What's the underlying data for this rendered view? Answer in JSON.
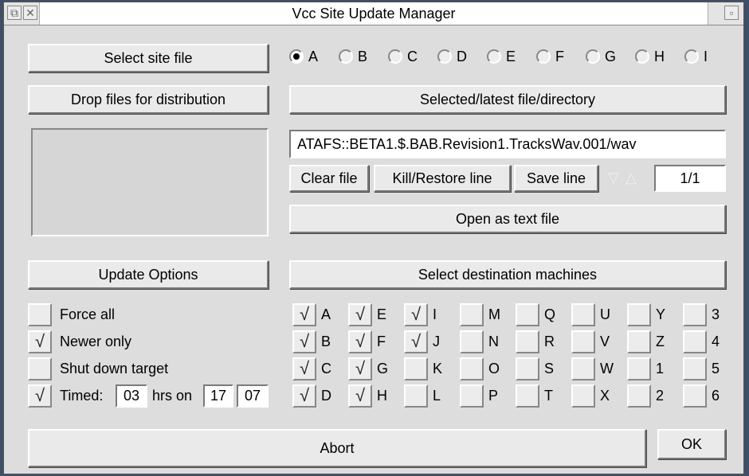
{
  "window": {
    "title": "Vcc Site Update Manager",
    "left_icons": [
      "⧉",
      "✕"
    ],
    "right_icon": "▫"
  },
  "left": {
    "select_site_label": "Select site file",
    "drop_files_label": "Drop files for distribution",
    "update_options_label": "Update Options",
    "options": [
      {
        "label": "Force all",
        "checked": false
      },
      {
        "label": "Newer only",
        "checked": true
      },
      {
        "label": "Shut down target",
        "checked": false
      }
    ],
    "timed": {
      "label": "Timed:",
      "checked": true,
      "hours": "03",
      "hrs_on": "hrs on",
      "day": "17",
      "month": "07"
    }
  },
  "right": {
    "radios": [
      {
        "label": "A",
        "selected": true
      },
      {
        "label": "B",
        "selected": false
      },
      {
        "label": "C",
        "selected": false
      },
      {
        "label": "D",
        "selected": false
      },
      {
        "label": "E",
        "selected": false
      },
      {
        "label": "F",
        "selected": false
      },
      {
        "label": "G",
        "selected": false
      },
      {
        "label": "H",
        "selected": false
      },
      {
        "label": "I",
        "selected": false
      }
    ],
    "selected_file_label": "Selected/latest file/directory",
    "path_value": "ATAFS::BETA1.$.BAB.Revision1.TracksWav.001/wav",
    "clear_file_label": "Clear file",
    "kill_restore_label": "Kill/Restore line",
    "save_line_label": "Save line",
    "counter": "1/1",
    "open_text_label": "Open as text file",
    "select_dest_label": "Select destination machines",
    "machines": [
      [
        {
          "label": "A",
          "checked": true
        },
        {
          "label": "B",
          "checked": true
        },
        {
          "label": "C",
          "checked": true
        },
        {
          "label": "D",
          "checked": true
        }
      ],
      [
        {
          "label": "E",
          "checked": true
        },
        {
          "label": "F",
          "checked": true
        },
        {
          "label": "G",
          "checked": true
        },
        {
          "label": "H",
          "checked": true
        }
      ],
      [
        {
          "label": "I",
          "checked": true
        },
        {
          "label": "J",
          "checked": true
        },
        {
          "label": "K",
          "checked": false
        },
        {
          "label": "L",
          "checked": false
        }
      ],
      [
        {
          "label": "M",
          "checked": false
        },
        {
          "label": "N",
          "checked": false
        },
        {
          "label": "O",
          "checked": false
        },
        {
          "label": "P",
          "checked": false
        }
      ],
      [
        {
          "label": "Q",
          "checked": false
        },
        {
          "label": "R",
          "checked": false
        },
        {
          "label": "S",
          "checked": false
        },
        {
          "label": "T",
          "checked": false
        }
      ],
      [
        {
          "label": "U",
          "checked": false
        },
        {
          "label": "V",
          "checked": false
        },
        {
          "label": "W",
          "checked": false
        },
        {
          "label": "X",
          "checked": false
        }
      ],
      [
        {
          "label": "Y",
          "checked": false
        },
        {
          "label": "Z",
          "checked": false
        },
        {
          "label": "1",
          "checked": false
        },
        {
          "label": "2",
          "checked": false
        }
      ],
      [
        {
          "label": "3",
          "checked": false
        },
        {
          "label": "4",
          "checked": false
        },
        {
          "label": "5",
          "checked": false
        },
        {
          "label": "6",
          "checked": false
        }
      ]
    ]
  },
  "bottom": {
    "abort_label": "Abort",
    "ok_label": "OK"
  },
  "check_glyph": "√"
}
